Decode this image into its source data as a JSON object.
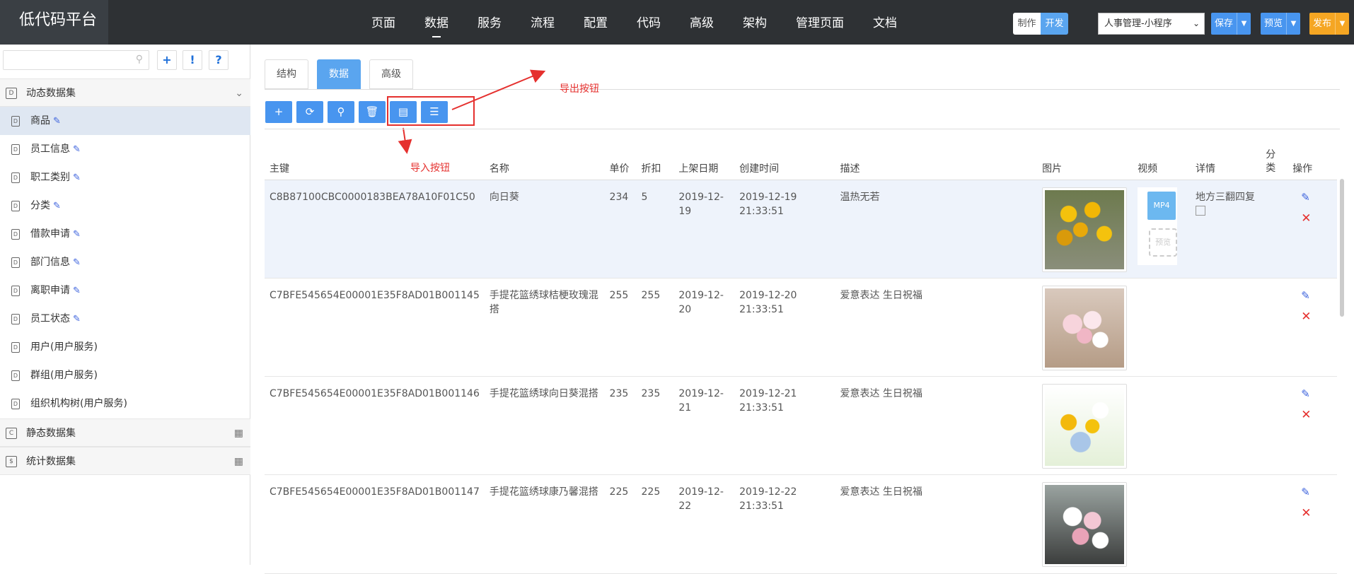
{
  "app": {
    "title": "低代码平台"
  },
  "topnav": [
    {
      "label": "页面",
      "active": false
    },
    {
      "label": "数据",
      "active": true
    },
    {
      "label": "服务",
      "active": false
    },
    {
      "label": "流程",
      "active": false
    },
    {
      "label": "配置",
      "active": false
    },
    {
      "label": "代码",
      "active": false
    },
    {
      "label": "高级",
      "active": false
    },
    {
      "label": "架构",
      "active": false
    },
    {
      "label": "管理页面",
      "active": false
    },
    {
      "label": "文档",
      "active": false
    }
  ],
  "mode": {
    "make": "制作",
    "dev": "开发"
  },
  "app_select": {
    "value": "人事管理-小程序"
  },
  "actions": {
    "save": "保存",
    "preview": "预览",
    "publish": "发布"
  },
  "colors": {
    "accent": "#4895ef",
    "orange": "#f5a623",
    "annotation": "#e5302e"
  },
  "sidebar": {
    "search_placeholder": "",
    "tools": [
      "+",
      "!",
      "?"
    ],
    "sections": [
      {
        "label": "动态数据集",
        "icon": "dynamic-dataset-icon"
      },
      {
        "label": "静态数据集",
        "icon": "static-dataset-icon"
      },
      {
        "label": "统计数据集",
        "icon": "stats-dataset-icon"
      }
    ],
    "items": [
      {
        "label": "商品",
        "editable": true
      },
      {
        "label": "员工信息",
        "editable": true
      },
      {
        "label": "职工类别",
        "editable": true
      },
      {
        "label": "分类",
        "editable": true
      },
      {
        "label": "借款申请",
        "editable": true
      },
      {
        "label": "部门信息",
        "editable": true
      },
      {
        "label": "离职申请",
        "editable": true
      },
      {
        "label": "员工状态",
        "editable": true
      },
      {
        "label": "用户(用户服务)",
        "editable": false
      },
      {
        "label": "群组(用户服务)",
        "editable": false
      },
      {
        "label": "组织机构树(用户服务)",
        "editable": false
      }
    ]
  },
  "tabs": [
    {
      "label": "结构",
      "active": false
    },
    {
      "label": "数据",
      "active": true
    },
    {
      "label": "高级",
      "active": false
    }
  ],
  "annotations": {
    "export": "导出按钮",
    "import": "导入按钮"
  },
  "table": {
    "columns": [
      "主键",
      "名称",
      "单价",
      "折扣",
      "上架日期",
      "创建时间",
      "描述",
      "图片",
      "视频",
      "详情",
      "分类",
      "操作"
    ],
    "rows": [
      {
        "id": "C8B87100CBC0000183BEA78A10F01C50",
        "name": "向日葵",
        "price": "234",
        "discount": "5",
        "date": "2019-12-19",
        "created": "2019-12-19 21:33:51",
        "desc": "温热无若",
        "has_video": true,
        "detail": "地方三翻四复",
        "selected": true
      },
      {
        "id": "C7BFE545654E00001E35F8AD01B001145",
        "name": "手提花篮绣球桔梗玫瑰混搭",
        "price": "255",
        "discount": "255",
        "date": "2019-12-20",
        "created": "2019-12-20 21:33:51",
        "desc": "爱意表达 生日祝福",
        "has_video": false,
        "detail": "",
        "selected": false
      },
      {
        "id": "C7BFE545654E00001E35F8AD01B001146",
        "name": "手提花篮绣球向日葵混搭",
        "price": "235",
        "discount": "235",
        "date": "2019-12-21",
        "created": "2019-12-21 21:33:51",
        "desc": "爱意表达 生日祝福",
        "has_video": false,
        "detail": "",
        "selected": false
      },
      {
        "id": "C7BFE545654E00001E35F8AD01B001147",
        "name": "手提花篮绣球康乃馨混搭",
        "price": "225",
        "discount": "225",
        "date": "2019-12-22",
        "created": "2019-12-22 21:33:51",
        "desc": "爱意表达 生日祝福",
        "has_video": false,
        "detail": "",
        "selected": false
      }
    ],
    "video": {
      "mp4": "MP4",
      "preview": "预览"
    }
  }
}
